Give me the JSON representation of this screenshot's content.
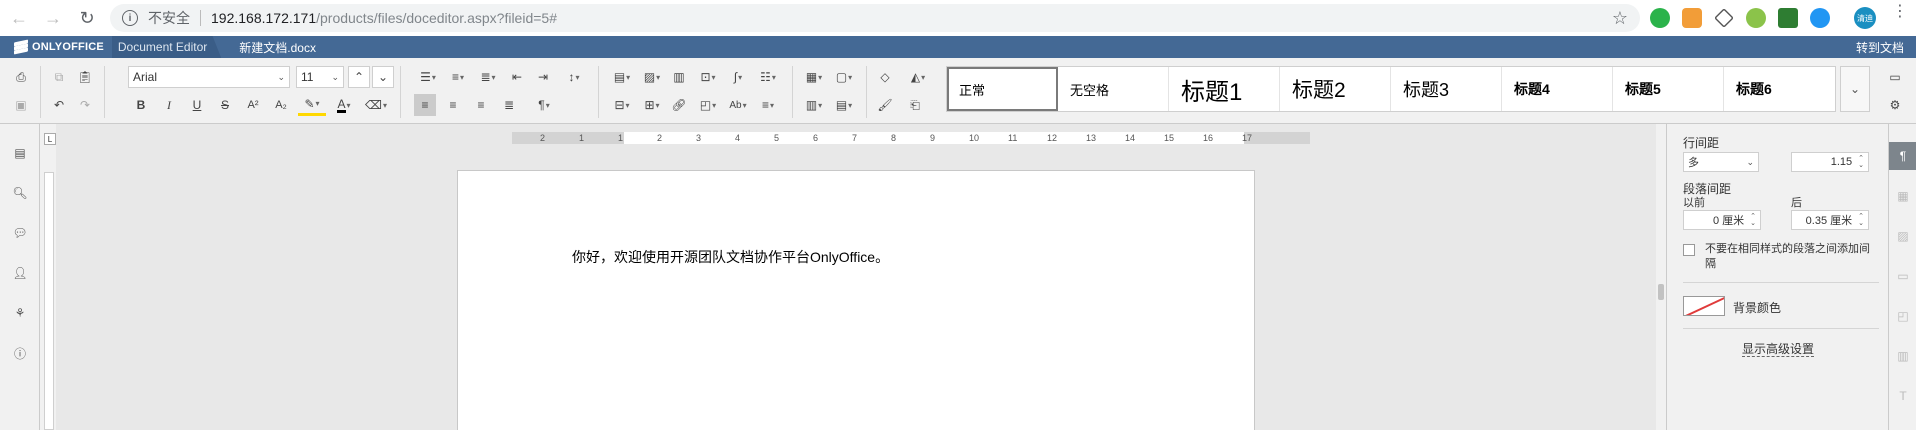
{
  "browser": {
    "security_label": "不安全",
    "url_host": "192.168.172.171",
    "url_path": "/products/files/doceditor.aspx?fileid=5#",
    "profile_initials": "清迪"
  },
  "app": {
    "brand": "ONLYOFFICE",
    "editor_name": "Document Editor",
    "doc_title": "新建文档.docx",
    "goto_docs": "转到文档"
  },
  "toolbar": {
    "font_name": "Arial",
    "font_size": "11",
    "styles": [
      "正常",
      "无空格",
      "标题1",
      "标题2",
      "标题3",
      "标题4",
      "标题5",
      "标题6"
    ]
  },
  "ruler": {
    "h_numbers": [
      "2",
      "1",
      "1",
      "2",
      "3",
      "4",
      "5",
      "6",
      "7",
      "8",
      "9",
      "10",
      "11",
      "12",
      "13",
      "14",
      "15",
      "16",
      "17"
    ]
  },
  "document": {
    "text": "你好，欢迎使用开源团队文档协作平台OnlyOffice。"
  },
  "paragraph_settings": {
    "line_spacing_label": "行间距",
    "line_spacing_mode": "多",
    "line_spacing_value": "1.15",
    "para_spacing_label": "段落间距",
    "before_label": "以前",
    "after_label": "后",
    "before_value": "0 厘米",
    "after_value": "0.35 厘米",
    "no_space_label": "不要在相同样式的段落之间添加间隔",
    "background_label": "背景颜色",
    "advanced_link": "显示高级设置"
  }
}
